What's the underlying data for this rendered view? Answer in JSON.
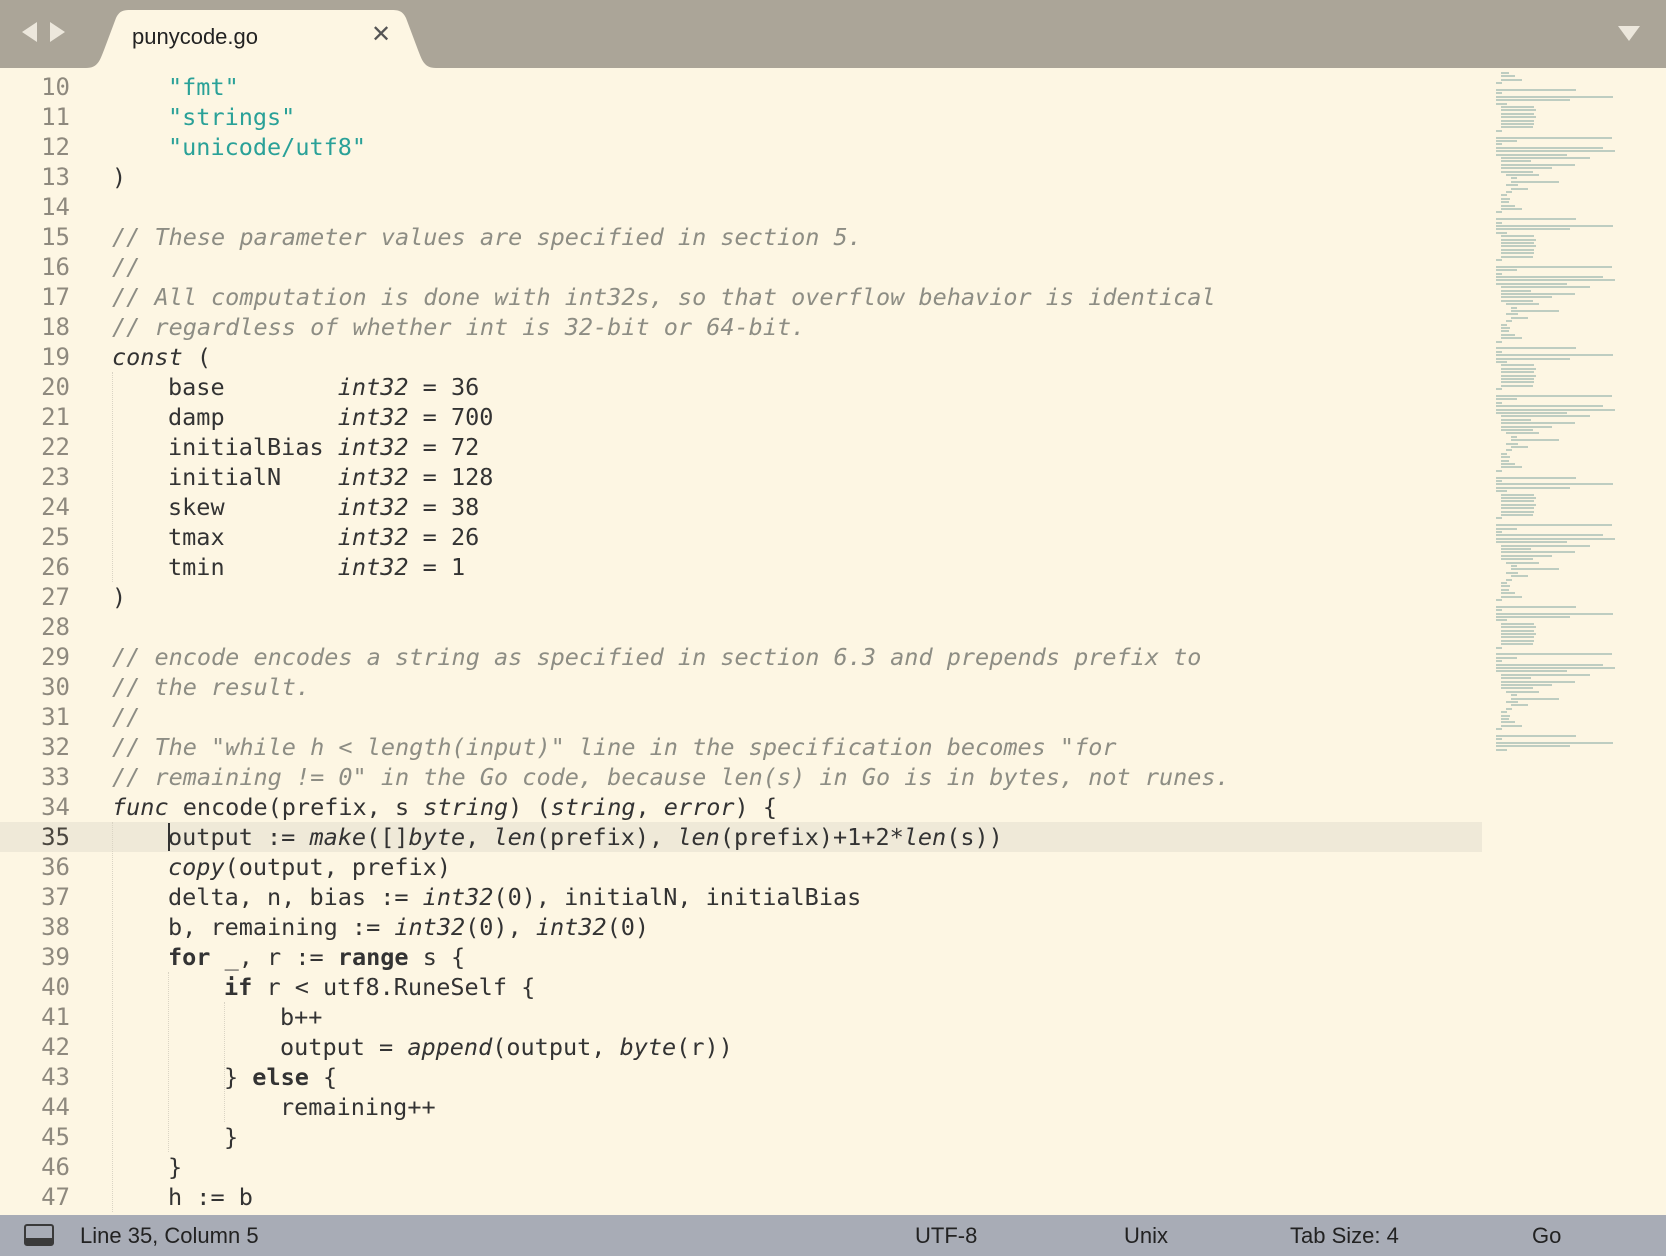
{
  "tab": {
    "title": "punycode.go",
    "close_glyph": "✕"
  },
  "icons": [
    "nav-back-icon",
    "nav-forward-icon",
    "close-icon",
    "dropdown-icon",
    "panel-toggle-icon"
  ],
  "colors": {
    "editor_bg": "#fdf6e3",
    "tabbar_bg": "#aba598",
    "statusbar_bg": "#a8acb6",
    "string": "#2aa198",
    "comment": "#8d8d84",
    "current_line": "#efe9d8"
  },
  "editor": {
    "current_line": 35,
    "cursor": "Line 35, Column 5",
    "lines": [
      {
        "n": "10",
        "indent": 1,
        "tokens": [
          {
            "t": "\"fmt\"",
            "c": "str"
          }
        ]
      },
      {
        "n": "11",
        "indent": 1,
        "tokens": [
          {
            "t": "\"strings\"",
            "c": "str"
          }
        ]
      },
      {
        "n": "12",
        "indent": 1,
        "tokens": [
          {
            "t": "\"unicode/utf8\"",
            "c": "str"
          }
        ]
      },
      {
        "n": "13",
        "indent": 0,
        "tokens": [
          {
            "t": ")"
          }
        ]
      },
      {
        "n": "14",
        "indent": 0,
        "tokens": []
      },
      {
        "n": "15",
        "indent": 0,
        "tokens": [
          {
            "t": "// These parameter values are specified in section 5.",
            "c": "com"
          }
        ]
      },
      {
        "n": "16",
        "indent": 0,
        "tokens": [
          {
            "t": "//",
            "c": "com"
          }
        ]
      },
      {
        "n": "17",
        "indent": 0,
        "tokens": [
          {
            "t": "// All computation is done with int32s, so that overflow behavior is identical",
            "c": "com"
          }
        ]
      },
      {
        "n": "18",
        "indent": 0,
        "tokens": [
          {
            "t": "// regardless of whether int is 32-bit or 64-bit.",
            "c": "com"
          }
        ]
      },
      {
        "n": "19",
        "indent": 0,
        "tokens": [
          {
            "t": "const",
            "c": "type"
          },
          {
            "t": " ("
          }
        ]
      },
      {
        "n": "20",
        "indent": 1,
        "tokens": [
          {
            "t": "base        "
          },
          {
            "t": "int32",
            "c": "type"
          },
          {
            "t": " = 36"
          }
        ]
      },
      {
        "n": "21",
        "indent": 1,
        "tokens": [
          {
            "t": "damp        "
          },
          {
            "t": "int32",
            "c": "type"
          },
          {
            "t": " = 700"
          }
        ]
      },
      {
        "n": "22",
        "indent": 1,
        "tokens": [
          {
            "t": "initialBias "
          },
          {
            "t": "int32",
            "c": "type"
          },
          {
            "t": " = 72"
          }
        ]
      },
      {
        "n": "23",
        "indent": 1,
        "tokens": [
          {
            "t": "initialN    "
          },
          {
            "t": "int32",
            "c": "type"
          },
          {
            "t": " = 128"
          }
        ]
      },
      {
        "n": "24",
        "indent": 1,
        "tokens": [
          {
            "t": "skew        "
          },
          {
            "t": "int32",
            "c": "type"
          },
          {
            "t": " = 38"
          }
        ]
      },
      {
        "n": "25",
        "indent": 1,
        "tokens": [
          {
            "t": "tmax        "
          },
          {
            "t": "int32",
            "c": "type"
          },
          {
            "t": " = 26"
          }
        ]
      },
      {
        "n": "26",
        "indent": 1,
        "tokens": [
          {
            "t": "tmin        "
          },
          {
            "t": "int32",
            "c": "type"
          },
          {
            "t": " = 1"
          }
        ]
      },
      {
        "n": "27",
        "indent": 0,
        "tokens": [
          {
            "t": ")"
          }
        ]
      },
      {
        "n": "28",
        "indent": 0,
        "tokens": []
      },
      {
        "n": "29",
        "indent": 0,
        "tokens": [
          {
            "t": "// encode encodes a string as specified in section 6.3 and prepends prefix to",
            "c": "com"
          }
        ]
      },
      {
        "n": "30",
        "indent": 0,
        "tokens": [
          {
            "t": "// the result.",
            "c": "com"
          }
        ]
      },
      {
        "n": "31",
        "indent": 0,
        "tokens": [
          {
            "t": "//",
            "c": "com"
          }
        ]
      },
      {
        "n": "32",
        "indent": 0,
        "tokens": [
          {
            "t": "// The \"while h < length(input)\" line in the specification becomes \"for",
            "c": "com"
          }
        ]
      },
      {
        "n": "33",
        "indent": 0,
        "tokens": [
          {
            "t": "// remaining != 0\" in the Go code, because len(s) in Go is in bytes, not runes.",
            "c": "com"
          }
        ]
      },
      {
        "n": "34",
        "indent": 0,
        "tokens": [
          {
            "t": "func",
            "c": "type"
          },
          {
            "t": " encode(prefix, s "
          },
          {
            "t": "string",
            "c": "type"
          },
          {
            "t": ") ("
          },
          {
            "t": "string",
            "c": "type"
          },
          {
            "t": ", "
          },
          {
            "t": "error",
            "c": "type"
          },
          {
            "t": ") {"
          }
        ]
      },
      {
        "n": "35",
        "indent": 1,
        "tokens": [
          {
            "t": "output := "
          },
          {
            "t": "make",
            "c": "builtin"
          },
          {
            "t": "([]"
          },
          {
            "t": "byte",
            "c": "type"
          },
          {
            "t": ", "
          },
          {
            "t": "len",
            "c": "builtin"
          },
          {
            "t": "(prefix), "
          },
          {
            "t": "len",
            "c": "builtin"
          },
          {
            "t": "(prefix)+1+2*"
          },
          {
            "t": "len",
            "c": "builtin"
          },
          {
            "t": "(s))"
          }
        ]
      },
      {
        "n": "36",
        "indent": 1,
        "tokens": [
          {
            "t": "copy",
            "c": "builtin"
          },
          {
            "t": "(output, prefix)"
          }
        ]
      },
      {
        "n": "37",
        "indent": 1,
        "tokens": [
          {
            "t": "delta, n, bias := "
          },
          {
            "t": "int32",
            "c": "type"
          },
          {
            "t": "(0), initialN, initialBias"
          }
        ]
      },
      {
        "n": "38",
        "indent": 1,
        "tokens": [
          {
            "t": "b, remaining := "
          },
          {
            "t": "int32",
            "c": "type"
          },
          {
            "t": "(0), "
          },
          {
            "t": "int32",
            "c": "type"
          },
          {
            "t": "(0)"
          }
        ]
      },
      {
        "n": "39",
        "indent": 1,
        "tokens": [
          {
            "t": "for",
            "c": "kw"
          },
          {
            "t": " _, r := "
          },
          {
            "t": "range",
            "c": "kw"
          },
          {
            "t": " s {"
          }
        ]
      },
      {
        "n": "40",
        "indent": 2,
        "tokens": [
          {
            "t": "if",
            "c": "kw"
          },
          {
            "t": " r < utf8.RuneSelf {"
          }
        ]
      },
      {
        "n": "41",
        "indent": 3,
        "tokens": [
          {
            "t": "b++"
          }
        ]
      },
      {
        "n": "42",
        "indent": 3,
        "tokens": [
          {
            "t": "output = "
          },
          {
            "t": "append",
            "c": "builtin"
          },
          {
            "t": "(output, "
          },
          {
            "t": "byte",
            "c": "type"
          },
          {
            "t": "(r))"
          }
        ]
      },
      {
        "n": "43",
        "indent": 2,
        "tokens": [
          {
            "t": "} "
          },
          {
            "t": "else",
            "c": "kw"
          },
          {
            "t": " {"
          }
        ]
      },
      {
        "n": "44",
        "indent": 3,
        "tokens": [
          {
            "t": "remaining++"
          }
        ]
      },
      {
        "n": "45",
        "indent": 2,
        "tokens": [
          {
            "t": "}"
          }
        ]
      },
      {
        "n": "46",
        "indent": 1,
        "tokens": [
          {
            "t": "}"
          }
        ]
      },
      {
        "n": "47",
        "indent": 1,
        "tokens": [
          {
            "t": "h := b"
          }
        ]
      }
    ]
  },
  "status": {
    "position": "Line 35, Column 5",
    "encoding": "UTF-8",
    "line_endings": "Unix",
    "tab_size": "Tab Size: 4",
    "syntax": "Go"
  }
}
